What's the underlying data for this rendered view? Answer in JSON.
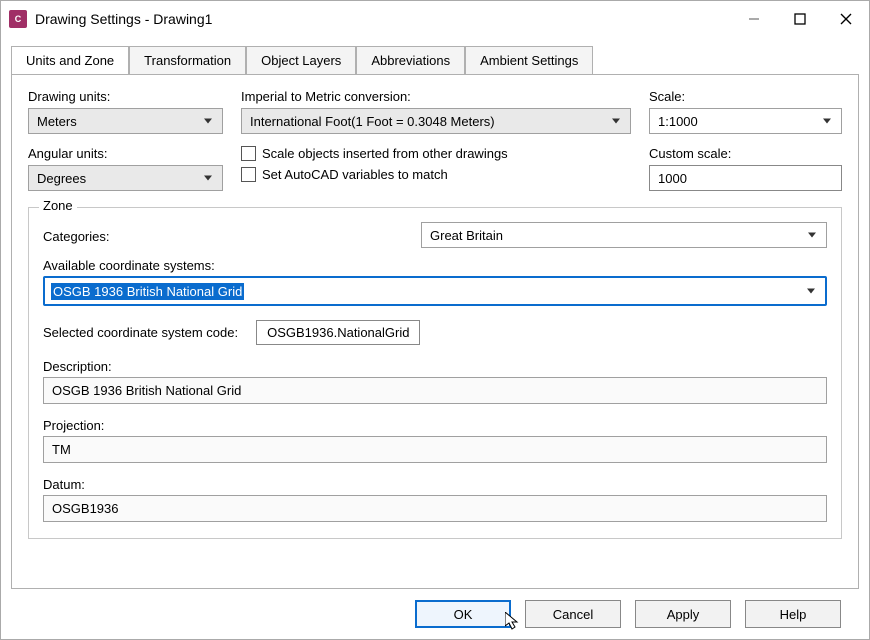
{
  "window": {
    "title": "Drawing Settings - Drawing1",
    "icon_letter": "C"
  },
  "tabs": [
    {
      "label": "Units and Zone",
      "active": true
    },
    {
      "label": "Transformation",
      "active": false
    },
    {
      "label": "Object Layers",
      "active": false
    },
    {
      "label": "Abbreviations",
      "active": false
    },
    {
      "label": "Ambient Settings",
      "active": false
    }
  ],
  "units": {
    "drawing_units_label": "Drawing units:",
    "drawing_units_value": "Meters",
    "angular_units_label": "Angular units:",
    "angular_units_value": "Degrees",
    "imperial_label": "Imperial to Metric conversion:",
    "imperial_value": "International Foot(1 Foot = 0.3048 Meters)",
    "chk_scale_objects": "Scale objects inserted from other drawings",
    "chk_autocad_vars": "Set AutoCAD variables to match",
    "scale_label": "Scale:",
    "scale_value": "1:1000",
    "custom_scale_label": "Custom scale:",
    "custom_scale_value": "1000"
  },
  "zone": {
    "legend": "Zone",
    "categories_label": "Categories:",
    "categories_value": "Great Britain",
    "available_label": "Available coordinate systems:",
    "available_value": "OSGB 1936 British National Grid",
    "selected_code_label": "Selected coordinate system code:",
    "selected_code_value": "OSGB1936.NationalGrid",
    "description_label": "Description:",
    "description_value": "OSGB 1936 British National Grid",
    "projection_label": "Projection:",
    "projection_value": "TM",
    "datum_label": "Datum:",
    "datum_value": "OSGB1936"
  },
  "buttons": {
    "ok": "OK",
    "cancel": "Cancel",
    "apply": "Apply",
    "help": "Help"
  }
}
